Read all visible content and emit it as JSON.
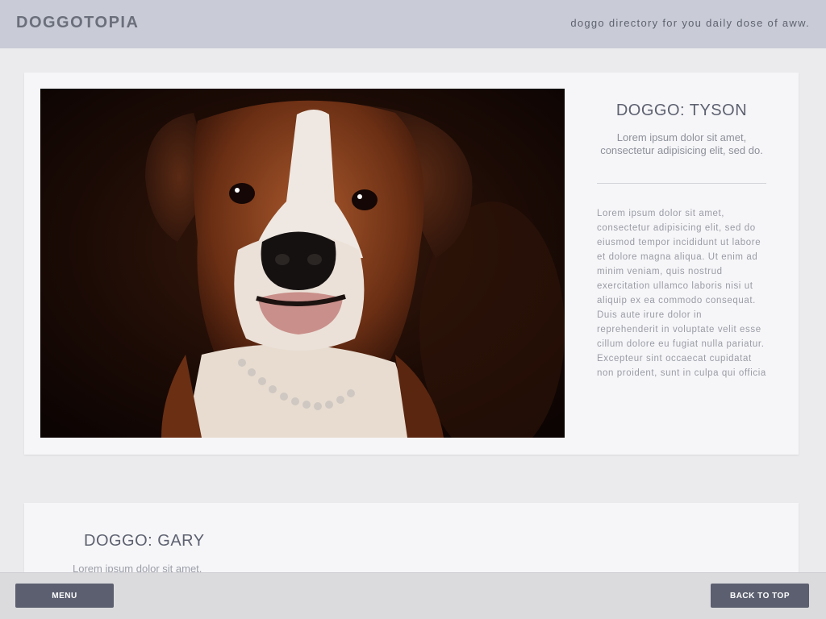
{
  "header": {
    "logo": "DOGGOTOPIA",
    "tagline": "doggo directory for you daily dose of aww."
  },
  "dogs": [
    {
      "title": "DOGGO: TYSON",
      "summary": "Lorem ipsum dolor sit amet, consectetur adipisicing elit, sed do.",
      "body": "Lorem ipsum dolor sit amet, consectetur adipisicing elit, sed do eiusmod tempor incididunt ut labore et dolore magna aliqua. Ut enim ad minim veniam, quis nostrud exercitation ullamco laboris nisi ut aliquip ex ea commodo consequat. Duis aute irure dolor in reprehenderit in voluptate velit esse cillum dolore eu fugiat nulla pariatur. Excepteur sint occaecat cupidatat non proident, sunt in culpa qui officia"
    },
    {
      "title": "DOGGO: GARY",
      "summary": "Lorem ipsum dolor sit amet,"
    }
  ],
  "footer": {
    "menu_label": "MENU",
    "back_to_top_label": "BACK TO TOP"
  }
}
